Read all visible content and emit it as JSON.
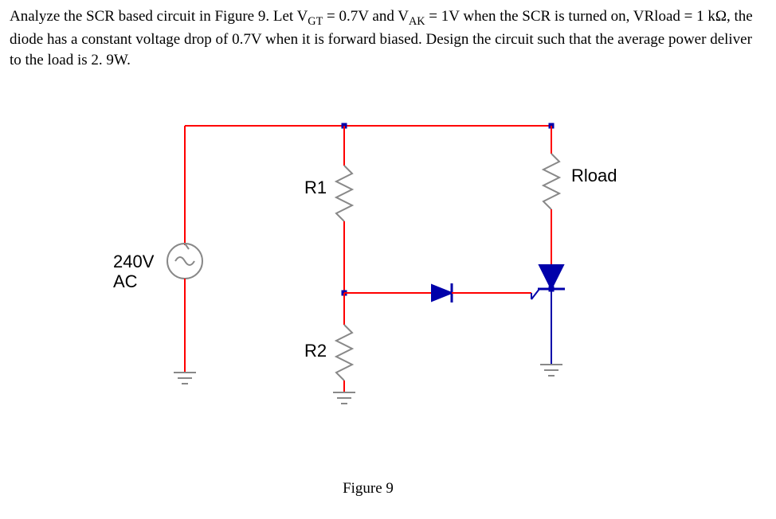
{
  "problem": {
    "text_parts": {
      "p1": "Analyze the SCR based circuit in Figure 9. Let V",
      "sub1": "GT",
      "p2": " = 0.7V and V",
      "sub2": "AK",
      "p3": " = 1V when the SCR is turned on, VRload = 1 kΩ, the diode has a constant voltage drop of 0.7V when it is forward biased. Design the circuit such that the average power deliver to the load is 2. 9W."
    }
  },
  "circuit": {
    "source_label": "240V",
    "source_type": "AC",
    "r1_label": "R1",
    "r2_label": "R2",
    "rload_label": "Rload",
    "figure_caption": "Figure 9"
  }
}
